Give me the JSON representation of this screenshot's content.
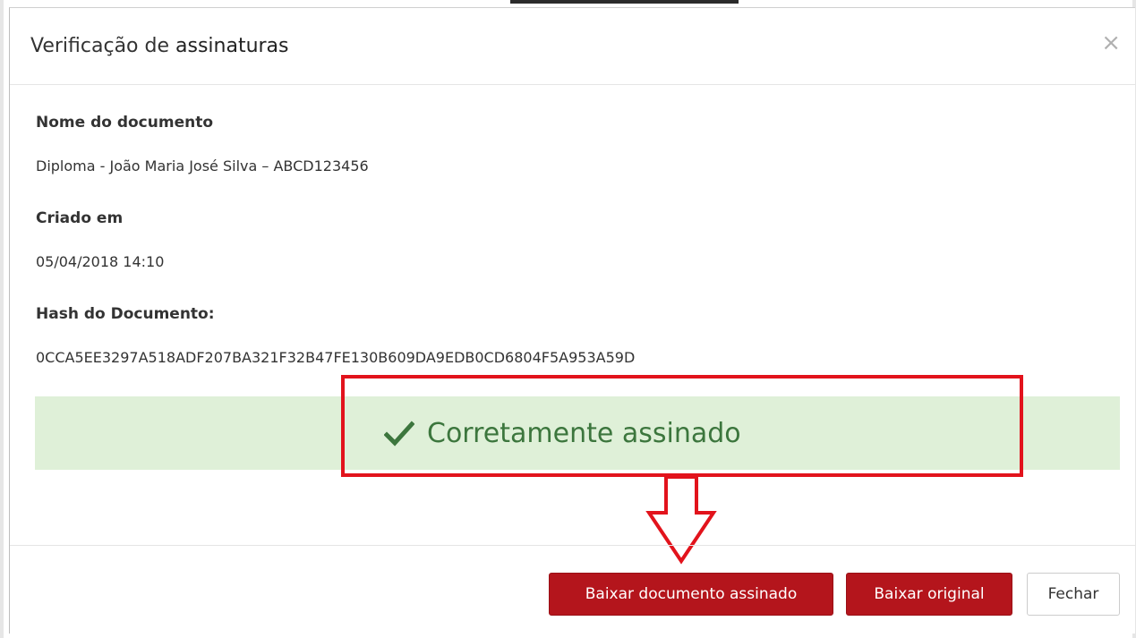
{
  "modal": {
    "title_prefix": "Verificação de ",
    "title_bold": "assinaturas",
    "close_glyph": "×"
  },
  "fields": {
    "document_name": {
      "label": "Nome do documento",
      "value": "Diploma - João Maria José Silva – ABCD123456"
    },
    "created_at": {
      "label": "Criado em",
      "value": "05/04/2018 14:10"
    },
    "hash": {
      "label": "Hash do Documento:",
      "value": "0CCA5EE3297A518ADF207BA321F32B47FE130B609DA9EDB0CD6804F5A953A59D"
    }
  },
  "status": {
    "message": "Corretamente assinado",
    "icon": "check-icon",
    "color": "#3c763d",
    "background": "#dff0d8"
  },
  "annotation": {
    "highlight_color": "#e2131c",
    "arrow_icon": "down-arrow-icon"
  },
  "footer": {
    "download_signed_label": "Baixar documento assinado",
    "download_original_label": "Baixar original",
    "close_label": "Fechar",
    "primary_color": "#b4151c"
  }
}
